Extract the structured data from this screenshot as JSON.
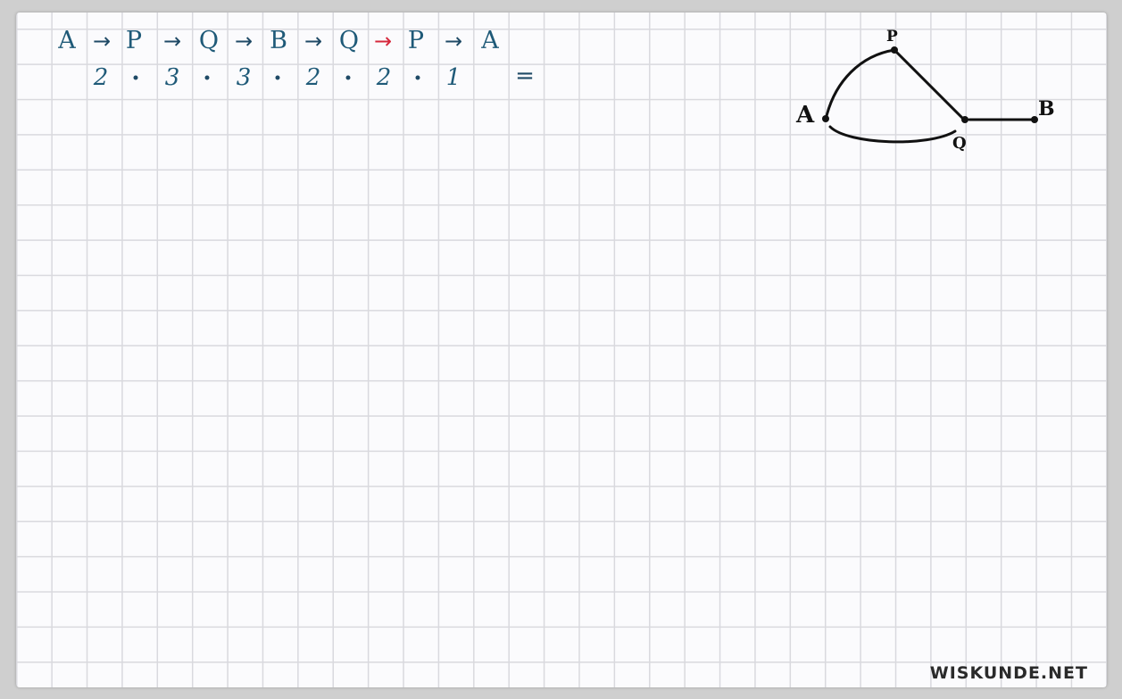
{
  "path_tokens": [
    "A",
    "P",
    "Q",
    "B",
    "Q",
    "P",
    "A"
  ],
  "arrows": [
    "→",
    "→",
    "→",
    "→",
    "→",
    "→"
  ],
  "highlighted_arrow_color": "#d6283c",
  "factors": [
    "2",
    "3",
    "3",
    "2",
    "2",
    "1"
  ],
  "multiply_sign": "·",
  "equals": "=",
  "graph": {
    "nodes": [
      "A",
      "P",
      "Q",
      "B"
    ],
    "edges": [
      [
        "A",
        "P"
      ],
      [
        "P",
        "Q"
      ],
      [
        "A",
        "Q"
      ],
      [
        "Q",
        "B"
      ]
    ]
  },
  "watermark": "WISKUNDE.NET"
}
